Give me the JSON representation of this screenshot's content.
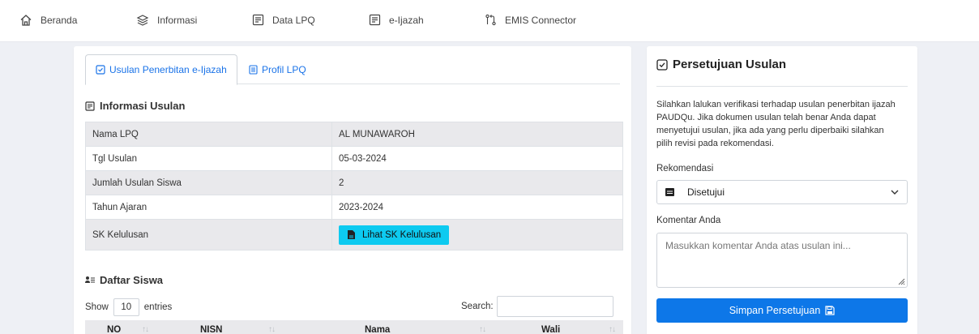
{
  "nav": {
    "items": [
      {
        "label": "Beranda",
        "icon": "home-icon"
      },
      {
        "label": "Informasi",
        "icon": "layers-icon"
      },
      {
        "label": "Data LPQ",
        "icon": "document-icon"
      },
      {
        "label": "e-Ijazah",
        "icon": "document-icon"
      },
      {
        "label": "EMIS Connector",
        "icon": "git-pull-icon"
      }
    ]
  },
  "tabs": [
    {
      "label": "Usulan Penerbitan e-Ijazah",
      "icon": "check-square-icon",
      "active": true
    },
    {
      "label": "Profil LPQ",
      "icon": "list-icon",
      "active": false
    }
  ],
  "info": {
    "title": "Informasi Usulan",
    "rows": [
      {
        "key": "Nama LPQ",
        "value": "AL MUNAWAROH"
      },
      {
        "key": "Tgl Usulan",
        "value": "05-03-2024"
      },
      {
        "key": "Jumlah Usulan Siswa",
        "value": "2"
      },
      {
        "key": "Tahun Ajaran",
        "value": "2023-2024"
      },
      {
        "key": "SK Kelulusan",
        "button": "Lihat SK Kelulusan"
      }
    ]
  },
  "students": {
    "title": "Daftar Siswa",
    "show_label": "Show",
    "entries_value": "10",
    "entries_label": "entries",
    "search_label": "Search:",
    "columns": [
      "NO",
      "NISN",
      "Nama",
      "Wali"
    ]
  },
  "approval": {
    "title": "Persetujuan Usulan",
    "description": "Silahkan lalukan verifikasi terhadap usulan penerbitan ijazah PAUDQu. Jika dokumen usulan telah benar Anda dapat menyetujui usulan, jika ada yang perlu diperbaiki silahkan pilih revisi pada rekomendasi.",
    "recommendation_label": "Rekomendasi",
    "recommendation_value": "Disetujui",
    "comment_label": "Komentar Anda",
    "comment_placeholder": "Masukkan komentar Anda atas usulan ini...",
    "save_label": "Simpan Persetujuan"
  },
  "colors": {
    "primary": "#0d77e8",
    "info_button": "#0dcaf0",
    "link": "#1a73e8"
  }
}
